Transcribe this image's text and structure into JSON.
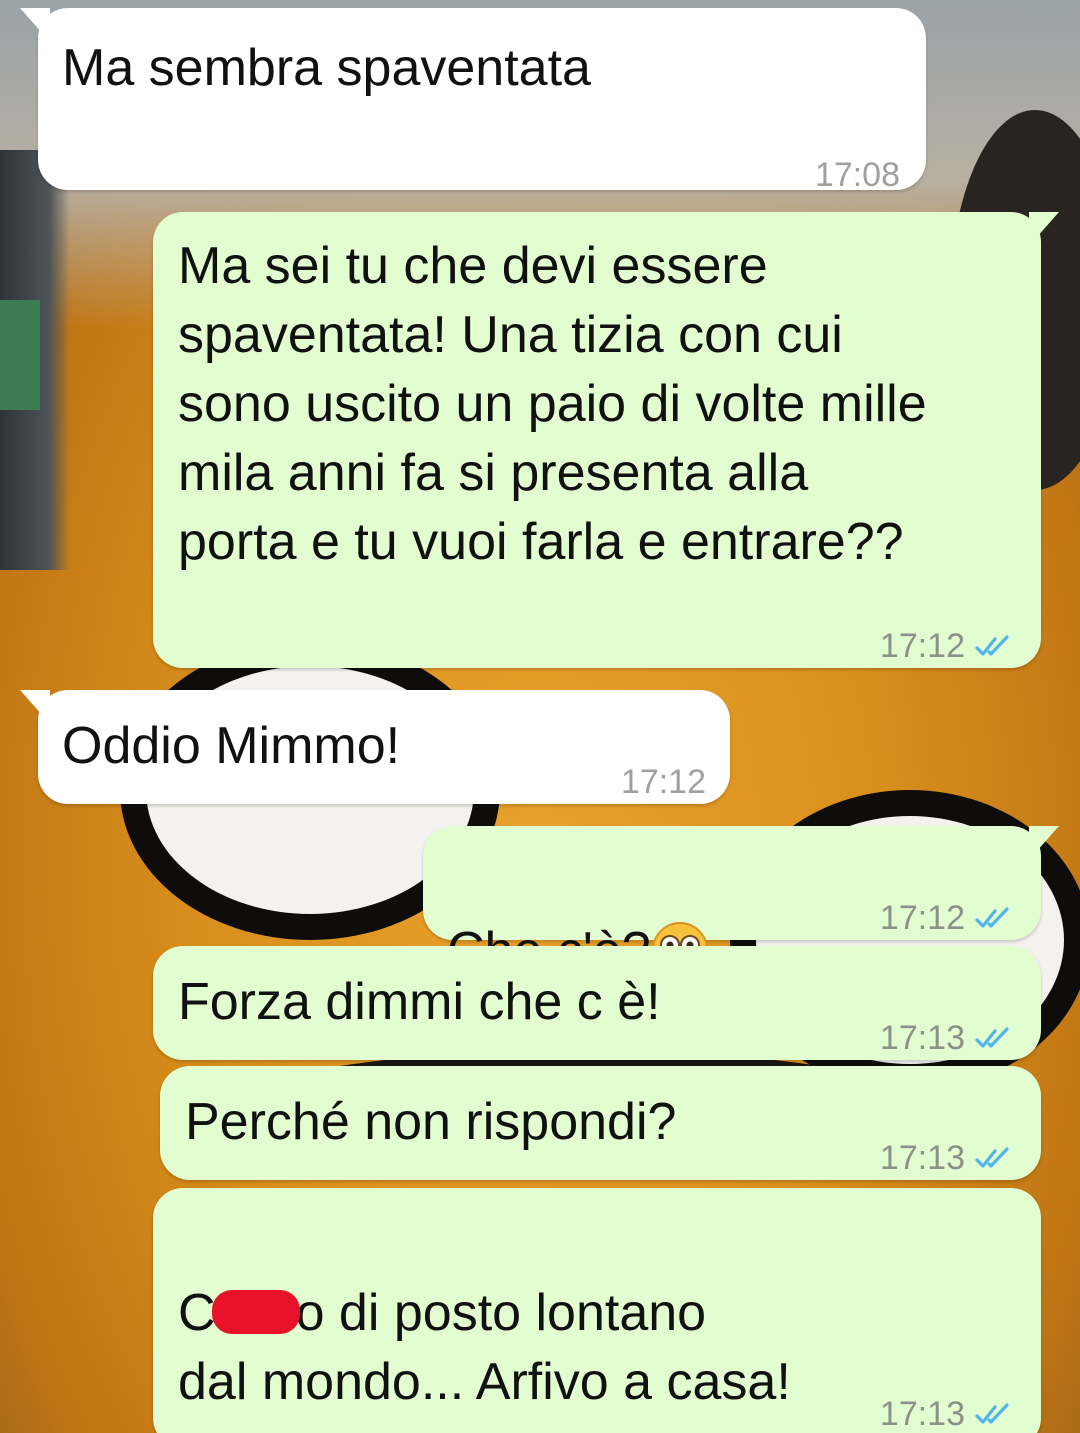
{
  "messages": [
    {
      "direction": "incoming",
      "text": "Ma sembra spaventata",
      "time": "17:08"
    },
    {
      "direction": "outgoing",
      "text": "Ma sei tu che devi essere\nspaventata! Una tizia con cui\nsono uscito un paio di volte mille\nmila anni fa si presenta alla\nporta e tu vuoi farla e entrare??",
      "time": "17:12",
      "status": "read-icon"
    },
    {
      "direction": "incoming",
      "text": "Oddio Mimmo!",
      "time": "17:12"
    },
    {
      "direction": "outgoing",
      "text": "Che c'è?",
      "emoji": "flushed-face-icon",
      "time": "17:12",
      "status": "read-icon"
    },
    {
      "direction": "outgoing",
      "text": "Forza dimmi che c è!",
      "time": "17:13",
      "status": "read-icon"
    },
    {
      "direction": "outgoing",
      "text": "Perché non rispondi?",
      "time": "17:13",
      "status": "read-icon"
    },
    {
      "direction": "outgoing",
      "text_before_redaction": "C",
      "text_after_redaction": "o di posto lontano",
      "text_line2": "dal mondo... Arfivo a casa!",
      "time": "17:13",
      "status": "read-icon"
    }
  ],
  "colors": {
    "incoming_bubble": "#ffffff",
    "outgoing_bubble": "#e2fdd0",
    "read_ticks": "#4fb6ec",
    "timestamp": "#8b9189",
    "redaction": "#e8132a"
  }
}
